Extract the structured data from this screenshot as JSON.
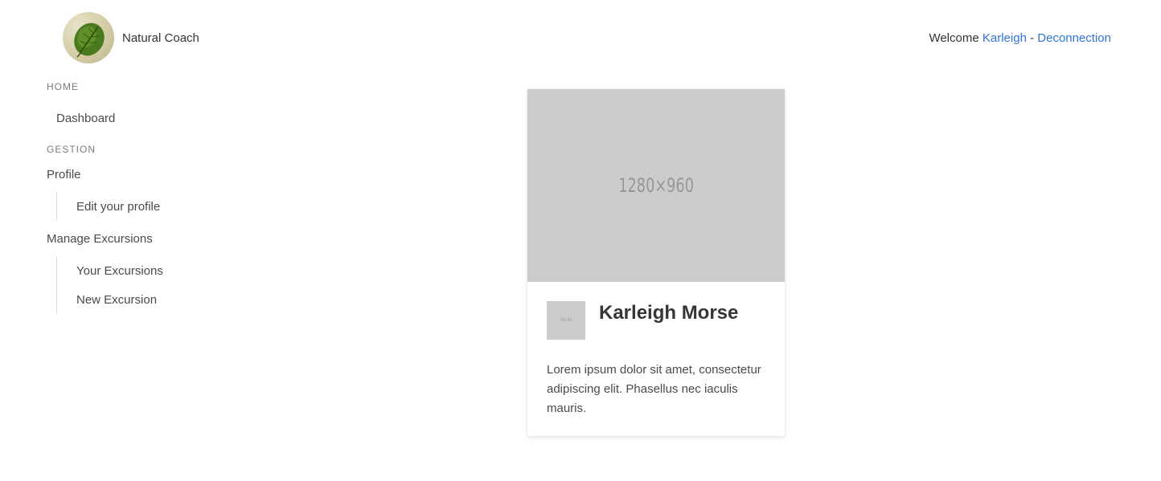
{
  "header": {
    "brand": "Natural Coach",
    "welcome_text": "Welcome",
    "user_name": "Karleigh",
    "separator": "-",
    "logout_label": "Deconnection"
  },
  "sidebar": {
    "home_label": "Home",
    "dashboard": "Dashboard",
    "gestion_label": "Gestion",
    "profile": "Profile",
    "edit_profile": "Edit your profile",
    "manage_excursions": "Manage Excursions",
    "your_excursions": "Your Excursions",
    "new_excursion": "New Excursion"
  },
  "card": {
    "image_placeholder": "1280×960",
    "thumb_placeholder": "96×96",
    "title": "Karleigh Morse",
    "content": "Lorem ipsum dolor sit amet, consectetur adipiscing elit. Phasellus nec iaculis mauris."
  },
  "colors": {
    "link": "#3273dc",
    "placeholder_bg": "#cccccc"
  }
}
